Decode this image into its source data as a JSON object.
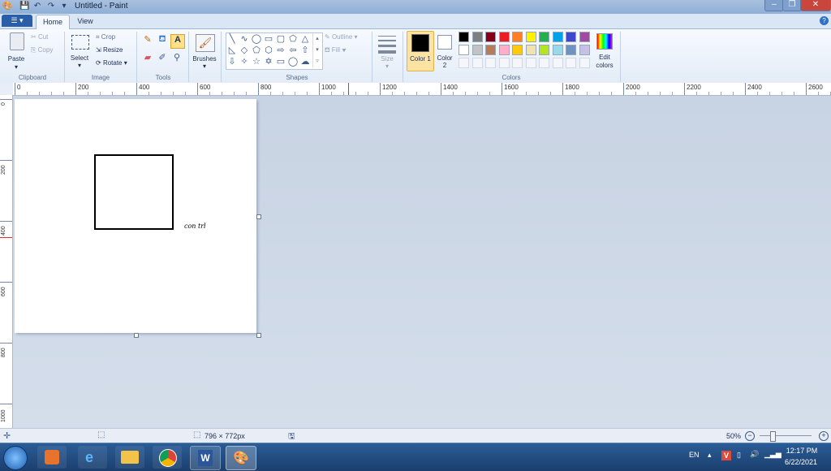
{
  "window": {
    "title": "Untitled - Paint"
  },
  "tabs": {
    "file_label": "☰ ▾",
    "home": "Home",
    "view": "View"
  },
  "clipboard": {
    "paste": "Paste",
    "cut": "Cut",
    "copy": "Copy",
    "group": "Clipboard"
  },
  "image": {
    "select": "Select",
    "crop": "Crop",
    "resize": "Resize",
    "rotate": "Rotate",
    "group": "Image"
  },
  "tools": {
    "group": "Tools"
  },
  "brushes": {
    "label": "Brushes"
  },
  "shapes": {
    "outline": "Outline",
    "fill": "Fill",
    "group": "Shapes"
  },
  "size": {
    "label": "Size"
  },
  "colors": {
    "color1_label": "Color 1",
    "color1_num": "1",
    "color2_label": "Color",
    "color2_num": "2",
    "edit_label": "Edit colors",
    "group": "Colors",
    "color1": "#000000",
    "color2": "#ffffff",
    "palette_row1": [
      "#000000",
      "#7f7f7f",
      "#880015",
      "#ed1c24",
      "#ff7f27",
      "#fff200",
      "#22b14c",
      "#00a2e8",
      "#3f48cc",
      "#a349a4"
    ],
    "palette_row2": [
      "#ffffff",
      "#c3c3c3",
      "#b97a57",
      "#ffaec9",
      "#ffc90e",
      "#efe4b0",
      "#b5e61d",
      "#99d9ea",
      "#7092be",
      "#c8bfe7"
    ]
  },
  "ruler": {
    "h_labels": [
      "0",
      "200",
      "400",
      "600",
      "800",
      "1000",
      "1200",
      "1400",
      "1600",
      "1800",
      "2000",
      "2200",
      "2400",
      "2600"
    ],
    "v_labels": [
      "0",
      "200",
      "400",
      "600",
      "800",
      "1000"
    ]
  },
  "canvas": {
    "text": "con trl"
  },
  "status": {
    "dimensions": "796 × 772px",
    "zoom": "50%"
  },
  "tray": {
    "lang": "EN",
    "time": "12:17 PM",
    "date": "6/22/2021"
  }
}
